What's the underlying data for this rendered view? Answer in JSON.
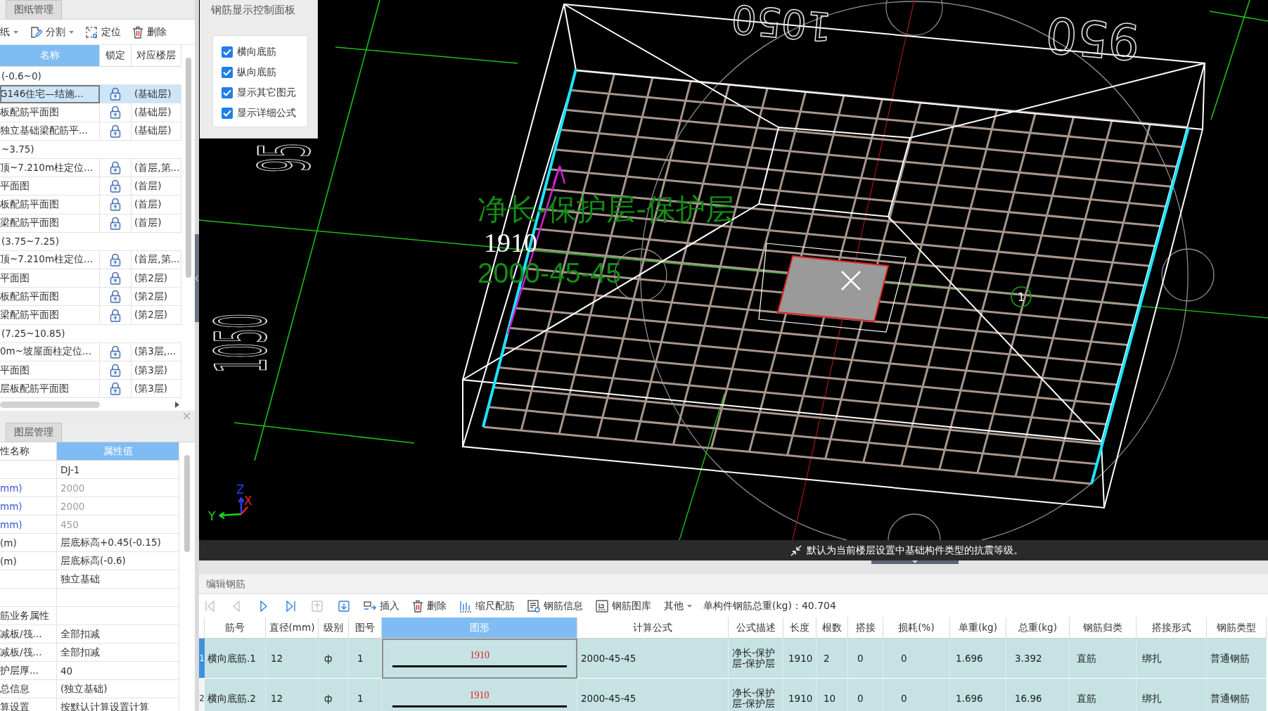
{
  "drawing_panel": {
    "tab": "图纸管理",
    "toolbar": [
      {
        "label": "纸",
        "dropdown": true
      },
      {
        "label": "分割",
        "dropdown": true
      },
      {
        "label": "定位",
        "dropdown": false
      },
      {
        "label": "删除",
        "dropdown": false
      }
    ],
    "columns": [
      {
        "label": "名称",
        "selected": true
      },
      {
        "label": "锁定",
        "selected": false
      },
      {
        "label": "对应楼层",
        "selected": false
      }
    ],
    "rows": [
      {
        "kind": "group",
        "name": "(-0.6~0)",
        "selected": false
      },
      {
        "kind": "drawing",
        "name": "G146住宅—结施...",
        "locked": true,
        "floor": "(基础层)",
        "selected": true
      },
      {
        "kind": "drawing",
        "name": "板配筋平面图",
        "locked": true,
        "floor": "(基础层)",
        "selected": false
      },
      {
        "kind": "drawing",
        "name": "独立基础梁配筋平...",
        "locked": true,
        "floor": "(基础层)",
        "selected": false
      },
      {
        "kind": "group",
        "name": "~3.75)",
        "selected": false
      },
      {
        "kind": "drawing",
        "name": "顶~7.210m柱定位...",
        "locked": true,
        "floor": "(首层,第...",
        "selected": false
      },
      {
        "kind": "drawing",
        "name": "平面图",
        "locked": true,
        "floor": "(首层)",
        "selected": false
      },
      {
        "kind": "drawing",
        "name": "板配筋平面图",
        "locked": true,
        "floor": "(首层)",
        "selected": false
      },
      {
        "kind": "drawing",
        "name": "梁配筋平面图",
        "locked": true,
        "floor": "(首层)",
        "selected": false
      },
      {
        "kind": "group",
        "name": "(3.75~7.25)",
        "selected": false
      },
      {
        "kind": "drawing",
        "name": "顶~7.210m柱定位...",
        "locked": true,
        "floor": "(首层,第...",
        "selected": false
      },
      {
        "kind": "drawing",
        "name": "平面图",
        "locked": true,
        "floor": "(第2层)",
        "selected": false
      },
      {
        "kind": "drawing",
        "name": "板配筋平面图",
        "locked": true,
        "floor": "(第2层)",
        "selected": false
      },
      {
        "kind": "drawing",
        "name": "梁配筋平面图",
        "locked": true,
        "floor": "(第2层)",
        "selected": false
      },
      {
        "kind": "group",
        "name": "(7.25~10.85)",
        "selected": false
      },
      {
        "kind": "drawing",
        "name": "0m~坡屋面柱定位...",
        "locked": true,
        "floor": "(第3层,...",
        "selected": false
      },
      {
        "kind": "drawing",
        "name": "平面图",
        "locked": true,
        "floor": "(第3层)",
        "selected": false
      },
      {
        "kind": "drawing",
        "name": "层板配筋平面图",
        "locked": true,
        "floor": "(第3层)",
        "selected": false
      }
    ]
  },
  "layer_panel": {
    "tab": "图层管理",
    "columns": [
      {
        "label": "性名称",
        "selected": false
      },
      {
        "label": "属性值",
        "selected": true
      }
    ],
    "rows": [
      {
        "value": "DJ-1",
        "disabled": false
      },
      {
        "name": "mm)",
        "value": "2000",
        "public": true,
        "disabled": true
      },
      {
        "name": "mm)",
        "value": "2000",
        "public": true,
        "disabled": true
      },
      {
        "name": "mm)",
        "value": "450",
        "public": true,
        "disabled": true
      },
      {
        "name": "(m)",
        "value": "层底标高+0.45(-0.15)",
        "public": false,
        "disabled": false
      },
      {
        "name": "(m)",
        "value": "层底标高(-0.6)",
        "public": false,
        "disabled": false
      },
      {
        "value": "独立基础",
        "disabled": false
      },
      {},
      {
        "name": "筋业务属性",
        "public": false
      },
      {
        "name": "减板/筏...",
        "value": "全部扣减",
        "public": false,
        "disabled": false
      },
      {
        "name": "减板/筏...",
        "value": "全部扣减",
        "public": false,
        "disabled": false
      },
      {
        "name": "护层厚...",
        "value": "40",
        "public": false,
        "disabled": false
      },
      {
        "name": "总信息",
        "value": "(独立基础)",
        "public": false,
        "disabled": false
      },
      {
        "name": "算设置",
        "value": "按默认计算设置计算",
        "public": false,
        "disabled": false
      }
    ]
  },
  "viewport": {
    "control_panel": {
      "title": "钢筋显示控制面板",
      "options": [
        {
          "label": "横向底筋",
          "checked": true
        },
        {
          "label": "纵向底筋",
          "checked": true
        },
        {
          "label": "显示其它图元",
          "checked": true
        },
        {
          "label": "显示详细公式",
          "checked": true
        }
      ]
    },
    "formula_description": "净长-保护层-保护层",
    "formula": "2000-45-45",
    "length": "1910",
    "rebar_number": "1",
    "cad_texts": [
      "1050",
      "950",
      "95",
      "1050"
    ],
    "axes": [
      {
        "label": "Y",
        "color": "#1fd21f"
      },
      {
        "label": "Z",
        "color": "#2a3cff"
      },
      {
        "label": "X",
        "color": "#ff2020"
      }
    ],
    "status": "默认为当前楼层设置中基础构件类型的抗震等级。"
  },
  "rebar_editor": {
    "title": "编辑钢筋",
    "nav": [
      {
        "disabled": true
      },
      {
        "disabled": true
      },
      {
        "disabled": false
      },
      {
        "disabled": false
      },
      {
        "disabled": true
      },
      {
        "disabled": false
      }
    ],
    "tools": [
      {
        "label": "插入",
        "dropdown": false
      },
      {
        "label": "删除",
        "dropdown": false
      },
      {
        "label": "缩尺配筋",
        "dropdown": false
      },
      {
        "label": "钢筋信息",
        "dropdown": false
      },
      {
        "label": "钢筋图库",
        "dropdown": false
      },
      {
        "label": "其他",
        "dropdown": true
      }
    ],
    "total_weight": "单构件钢筋总重(kg)：40.704",
    "columns": [
      {
        "label": "筋号",
        "selected": false
      },
      {
        "label": "直径(mm)",
        "selected": false
      },
      {
        "label": "级别",
        "selected": false
      },
      {
        "label": "图号",
        "selected": false
      },
      {
        "label": "图形",
        "selected": true
      },
      {
        "label": "计算公式",
        "selected": false
      },
      {
        "label": "公式描述",
        "selected": false
      },
      {
        "label": "长度",
        "selected": false
      },
      {
        "label": "根数",
        "selected": false
      },
      {
        "label": "搭接",
        "selected": false
      },
      {
        "label": "损耗(%)",
        "selected": false
      },
      {
        "label": "单重(kg)",
        "selected": false
      },
      {
        "label": "总重(kg)",
        "selected": false
      },
      {
        "label": "钢筋归类",
        "selected": false
      },
      {
        "label": "搭接形式",
        "selected": false
      },
      {
        "label": "钢筋类型",
        "selected": false
      }
    ],
    "rows": [
      {
        "number": "1",
        "selected": true,
        "cells": [
          "横向底筋.1",
          "12",
          "ф",
          "1",
          "1910",
          "2000-45-45",
          "净长-保护层-保护层",
          "1910",
          "2",
          "0",
          "0",
          "1.696",
          "3.392",
          "直筋",
          "绑扎",
          "普通钢筋"
        ]
      },
      {
        "number": "2",
        "selected": false,
        "cells": [
          "横向底筋.2",
          "12",
          "ф",
          "1",
          "1910",
          "2000-45-45",
          "净长-保护层-保护层",
          "1910",
          "10",
          "0",
          "0",
          "1.696",
          "16.96",
          "直筋",
          "绑扎",
          "普通钢筋"
        ]
      }
    ]
  }
}
